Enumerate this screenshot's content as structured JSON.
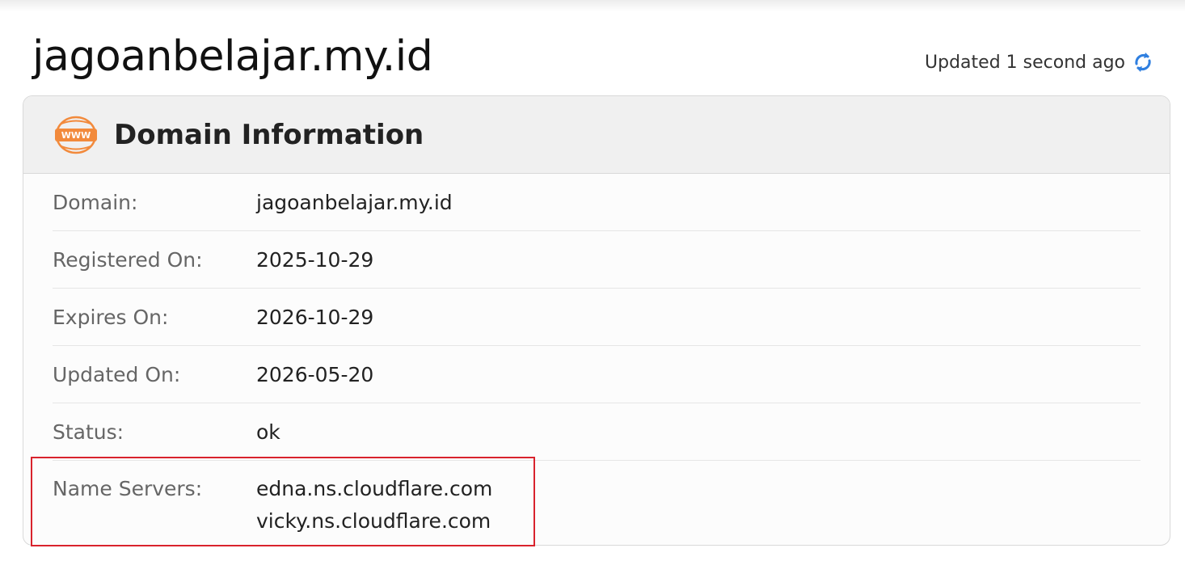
{
  "page": {
    "title": "jagoanbelajar.my.id",
    "updated_text": "Updated 1 second ago"
  },
  "card": {
    "title": "Domain Information",
    "icon_text": "WWW",
    "rows": [
      {
        "label": "Domain:",
        "value": "jagoanbelajar.my.id"
      },
      {
        "label": "Registered On:",
        "value": "2025-10-29"
      },
      {
        "label": "Expires On:",
        "value": "2026-10-29"
      },
      {
        "label": "Updated On:",
        "value": "2026-05-20"
      },
      {
        "label": "Status:",
        "value": "ok"
      }
    ],
    "name_servers": {
      "label": "Name Servers:",
      "values": [
        "edna.ns.cloudflare.com",
        "vicky.ns.cloudflare.com"
      ]
    }
  },
  "colors": {
    "accent_blue": "#2f7fe0",
    "www_orange": "#f28a3c",
    "highlight_red": "#d9232d"
  },
  "icons": [
    "refresh-icon",
    "www-globe-icon"
  ]
}
